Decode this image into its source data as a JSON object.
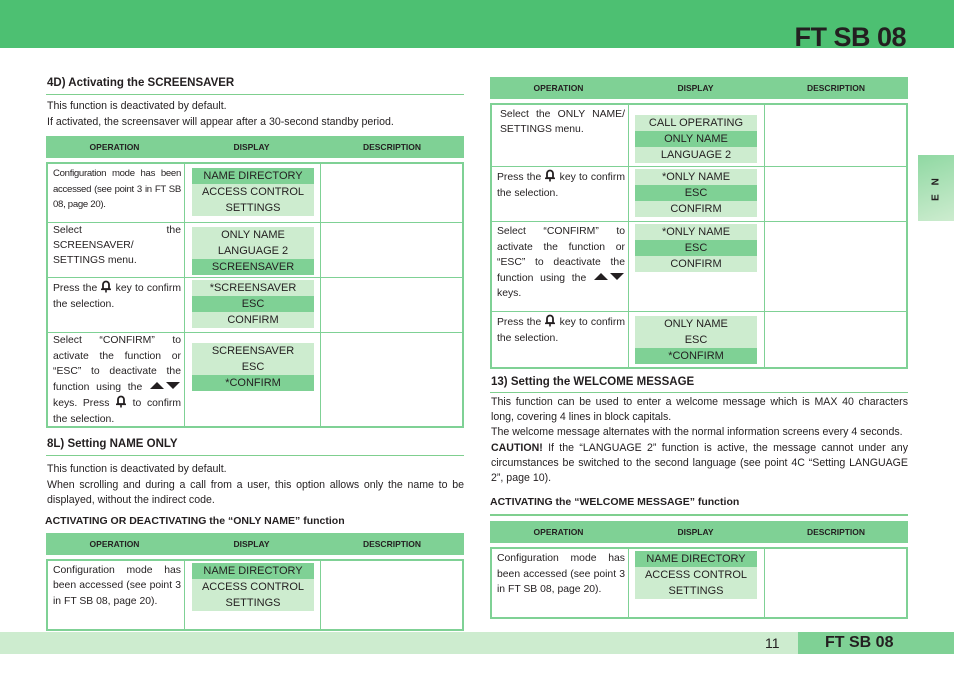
{
  "header": {
    "title": "FT SB 08",
    "band_color": "#4dc072"
  },
  "language_tab": {
    "label": "E N"
  },
  "colors": {
    "table_header": "#7fd195",
    "lcd_light": "#cdeccf",
    "lcd_selected": "#7fd195",
    "rule": "#7fcf8f"
  },
  "table_headers": {
    "operation": "OPERATION",
    "display": "DISPLAY",
    "description": "DESCRIPTION"
  },
  "icons": {
    "bell": "bell-key-icon",
    "updown": "up-down-arrow-keys-icon"
  },
  "left": {
    "screensaver": {
      "title": "4D) Activating the SCREENSAVER",
      "para1": "This function is deactivated by default.",
      "para2": "If activated, the screensaver will appear after a 30-second standby period.",
      "rows": [
        {
          "op": "Configuration mode has been accessed (see point 3 in FT SB 08, page 20).",
          "lines": [
            "NAME DIRECTORY",
            "ACCESS CONTROL",
            "SETTINGS"
          ],
          "selected": 0
        },
        {
          "op": "Select the SCREENSAVER/ SETTINGS menu.",
          "lines": [
            "ONLY NAME",
            "LANGUAGE 2",
            "SCREENSAVER"
          ],
          "selected": 2
        },
        {
          "op_pre": "Press the",
          "op_post": "key to confirm the selection.",
          "lines": [
            "*SCREENSAVER",
            "ESC",
            "CONFIRM"
          ],
          "selected": 1
        },
        {
          "op_pre": "Select “CONFIRM” to activate the function or “ESC” to deactivate the function using the",
          "op_mid": "keys. Press",
          "op_post": "to confirm the selection.",
          "lines": [
            "SCREENSAVER",
            "ESC",
            "*CONFIRM"
          ],
          "selected": 2
        }
      ]
    },
    "nameonly": {
      "title": "8L) Setting NAME ONLY",
      "para1": "This function is deactivated by default.",
      "para2": "When scrolling and during a call from a user, this option allows only the name to be displayed, without the indirect code.",
      "subhead": "ACTIVATING OR DEACTIVATING the “ONLY NAME” function",
      "rows": [
        {
          "op": "Configuration mode has been accessed (see point 3 in FT SB 08, page 20).",
          "lines": [
            "NAME DIRECTORY",
            "ACCESS CONTROL",
            "SETTINGS"
          ],
          "selected": 0
        }
      ]
    }
  },
  "right": {
    "nameonly_cont": {
      "rows": [
        {
          "op": "Select the ONLY NAME/ SETTINGS menu.",
          "lines": [
            "CALL OPERATING",
            "ONLY NAME",
            "LANGUAGE 2"
          ],
          "selected": 1
        },
        {
          "op_pre": "Press the",
          "op_post": "key to confirm the selection.",
          "lines": [
            "*ONLY NAME",
            "ESC",
            "CONFIRM"
          ],
          "selected": 1
        },
        {
          "op_pre": "Select “CONFIRM” to activate the function or “ESC” to deactivate the function using the",
          "op_post": "keys.",
          "lines": [
            "*ONLY NAME",
            "ESC",
            "CONFIRM"
          ],
          "selected": 1
        },
        {
          "op_pre": "Press the",
          "op_post": "key to confirm the selection.",
          "lines": [
            "ONLY NAME",
            "ESC",
            "*CONFIRM"
          ],
          "selected": 2
        }
      ]
    },
    "welcome": {
      "title": "13) Setting the WELCOME MESSAGE",
      "para1": "This function can be used to enter a welcome message which is MAX 40 characters long, covering 4 lines in block capitals.",
      "para2": "The welcome message alternates with the normal information screens every 4 seconds.",
      "caution_label": "CAUTION!",
      "caution_text": " If the “LANGUAGE 2” function is active, the message cannot under any circumstances be switched to the second language (see point 4C “Setting LANGUAGE 2”, page 10).",
      "subhead": "ACTIVATING the “WELCOME MESSAGE” function",
      "rows": [
        {
          "op": "Configuration mode has been accessed (see point 3 in FT SB 08, page 20).",
          "lines": [
            "NAME DIRECTORY",
            "ACCESS CONTROL",
            "SETTINGS"
          ],
          "selected": 0
        }
      ]
    }
  },
  "footer": {
    "page_number": "11",
    "title": "FT SB 08"
  }
}
